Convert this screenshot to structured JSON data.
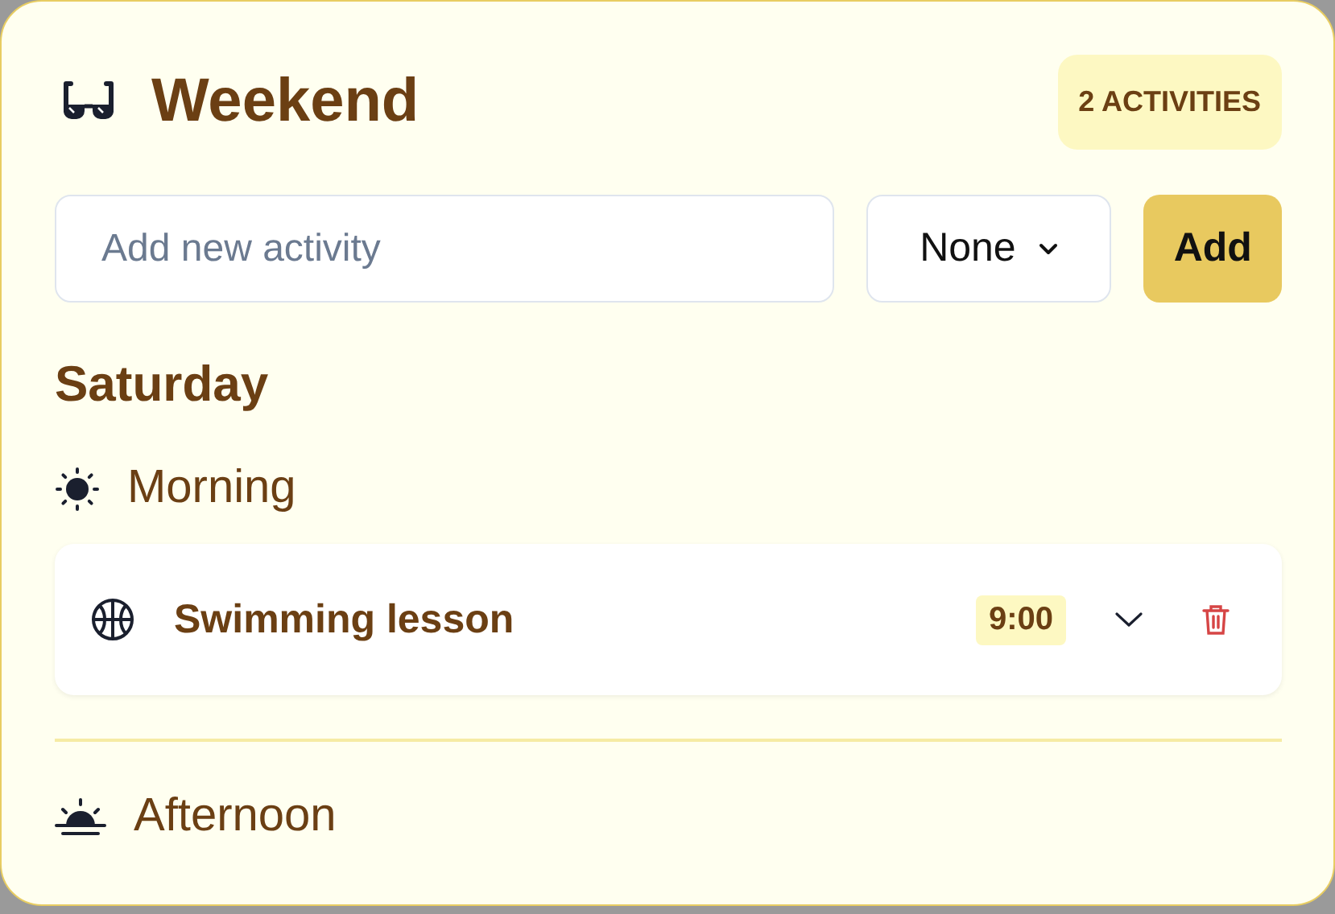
{
  "title": "Weekend",
  "badge": "2 ACTIVITIES",
  "new_activity": {
    "placeholder": "Add new activity"
  },
  "period_select": {
    "value": "None"
  },
  "add_button": "Add",
  "day": "Saturday",
  "periods": [
    {
      "kind": "morning",
      "label": "Morning",
      "activities": [
        {
          "name": "Swimming lesson",
          "time": "9:00"
        }
      ]
    },
    {
      "kind": "afternoon",
      "label": "Afternoon"
    }
  ]
}
